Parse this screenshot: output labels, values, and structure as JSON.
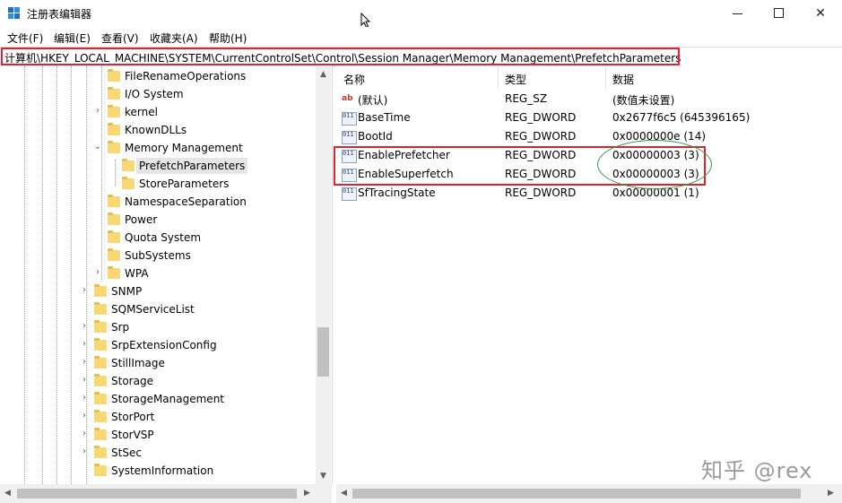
{
  "window": {
    "title": "注册表编辑器",
    "controls": {
      "minimize": "minimize-icon",
      "maximize": "maximize-icon",
      "close": "✕"
    }
  },
  "menu": [
    "文件(F)",
    "编辑(E)",
    "查看(V)",
    "收藏夹(A)",
    "帮助(H)"
  ],
  "address": "计算机\\HKEY_LOCAL_MACHINE\\SYSTEM\\CurrentControlSet\\Control\\Session Manager\\Memory Management\\PrefetchParameters",
  "tree": {
    "items": [
      {
        "label": "FileRenameOperations",
        "level": 3,
        "expander": ""
      },
      {
        "label": "I/O System",
        "level": 3,
        "expander": ""
      },
      {
        "label": "kernel",
        "level": 3,
        "expander": "›"
      },
      {
        "label": "KnownDLLs",
        "level": 3,
        "expander": ""
      },
      {
        "label": "Memory Management",
        "level": 3,
        "expander": "⌄"
      },
      {
        "label": "PrefetchParameters",
        "level": 4,
        "expander": "",
        "selected": true
      },
      {
        "label": "StoreParameters",
        "level": 4,
        "expander": ""
      },
      {
        "label": "NamespaceSeparation",
        "level": 3,
        "expander": ""
      },
      {
        "label": "Power",
        "level": 3,
        "expander": ""
      },
      {
        "label": "Quota System",
        "level": 3,
        "expander": ""
      },
      {
        "label": "SubSystems",
        "level": 3,
        "expander": ""
      },
      {
        "label": "WPA",
        "level": 3,
        "expander": "›"
      },
      {
        "label": "SNMP",
        "level": 2,
        "expander": "›"
      },
      {
        "label": "SQMServiceList",
        "level": 2,
        "expander": ""
      },
      {
        "label": "Srp",
        "level": 2,
        "expander": "›"
      },
      {
        "label": "SrpExtensionConfig",
        "level": 2,
        "expander": "›"
      },
      {
        "label": "StillImage",
        "level": 2,
        "expander": "›"
      },
      {
        "label": "Storage",
        "level": 2,
        "expander": "›"
      },
      {
        "label": "StorageManagement",
        "level": 2,
        "expander": "›"
      },
      {
        "label": "StorPort",
        "level": 2,
        "expander": "›"
      },
      {
        "label": "StorVSP",
        "level": 2,
        "expander": "›"
      },
      {
        "label": "StSec",
        "level": 2,
        "expander": "›"
      },
      {
        "label": "SystemInformation",
        "level": 2,
        "expander": ""
      }
    ]
  },
  "list": {
    "columns": {
      "name": "名称",
      "type": "类型",
      "data": "数据"
    },
    "rows": [
      {
        "icon": "string-value-icon",
        "name": "(默认)",
        "type": "REG_SZ",
        "data": "(数值未设置)"
      },
      {
        "icon": "binary-value-icon",
        "name": "BaseTime",
        "type": "REG_DWORD",
        "data": "0x2677f6c5 (645396165)"
      },
      {
        "icon": "binary-value-icon",
        "name": "BootId",
        "type": "REG_DWORD",
        "data": "0x0000000e (14)"
      },
      {
        "icon": "binary-value-icon",
        "name": "EnablePrefetcher",
        "type": "REG_DWORD",
        "data": "0x00000003 (3)"
      },
      {
        "icon": "binary-value-icon",
        "name": "EnableSuperfetch",
        "type": "REG_DWORD",
        "data": "0x00000003 (3)"
      },
      {
        "icon": "binary-value-icon",
        "name": "SfTracingState",
        "type": "REG_DWORD",
        "data": "0x00000001 (1)"
      }
    ]
  },
  "watermark": "知乎 @rex",
  "colors": {
    "annotation_red": "#e0232e",
    "annotation_green": "#2f9a48",
    "folder": "#f8d775"
  }
}
